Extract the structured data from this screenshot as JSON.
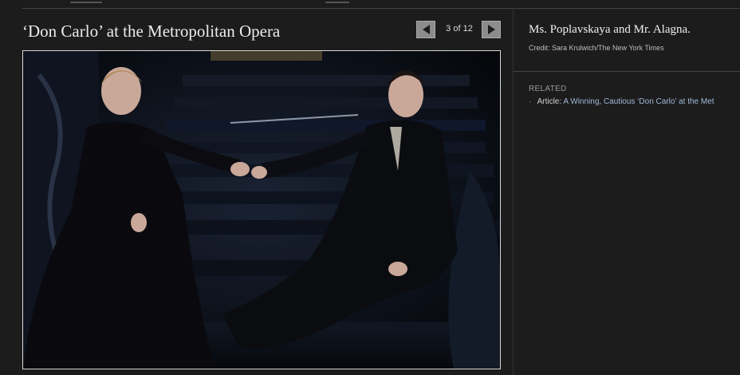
{
  "slideshow": {
    "title": "‘Don Carlo’ at the Metropolitan Opera",
    "counter": "3 of 12",
    "prev_icon": "triangle-left-icon",
    "next_icon": "triangle-right-icon"
  },
  "photo_alt": "",
  "caption": {
    "text": "Ms. Poplavskaya and Mr. Alagna.",
    "credit": "Credit: Sara Krulwich/The New York Times"
  },
  "related": {
    "label": "RELATED",
    "items": [
      {
        "type": "Article:",
        "title": "A Winning, Cautious ‘Don Carlo’ at the Met"
      }
    ]
  },
  "colors": {
    "background": "#1c1c1c",
    "link": "#9fb9d8",
    "button": "#8c8c8c"
  }
}
